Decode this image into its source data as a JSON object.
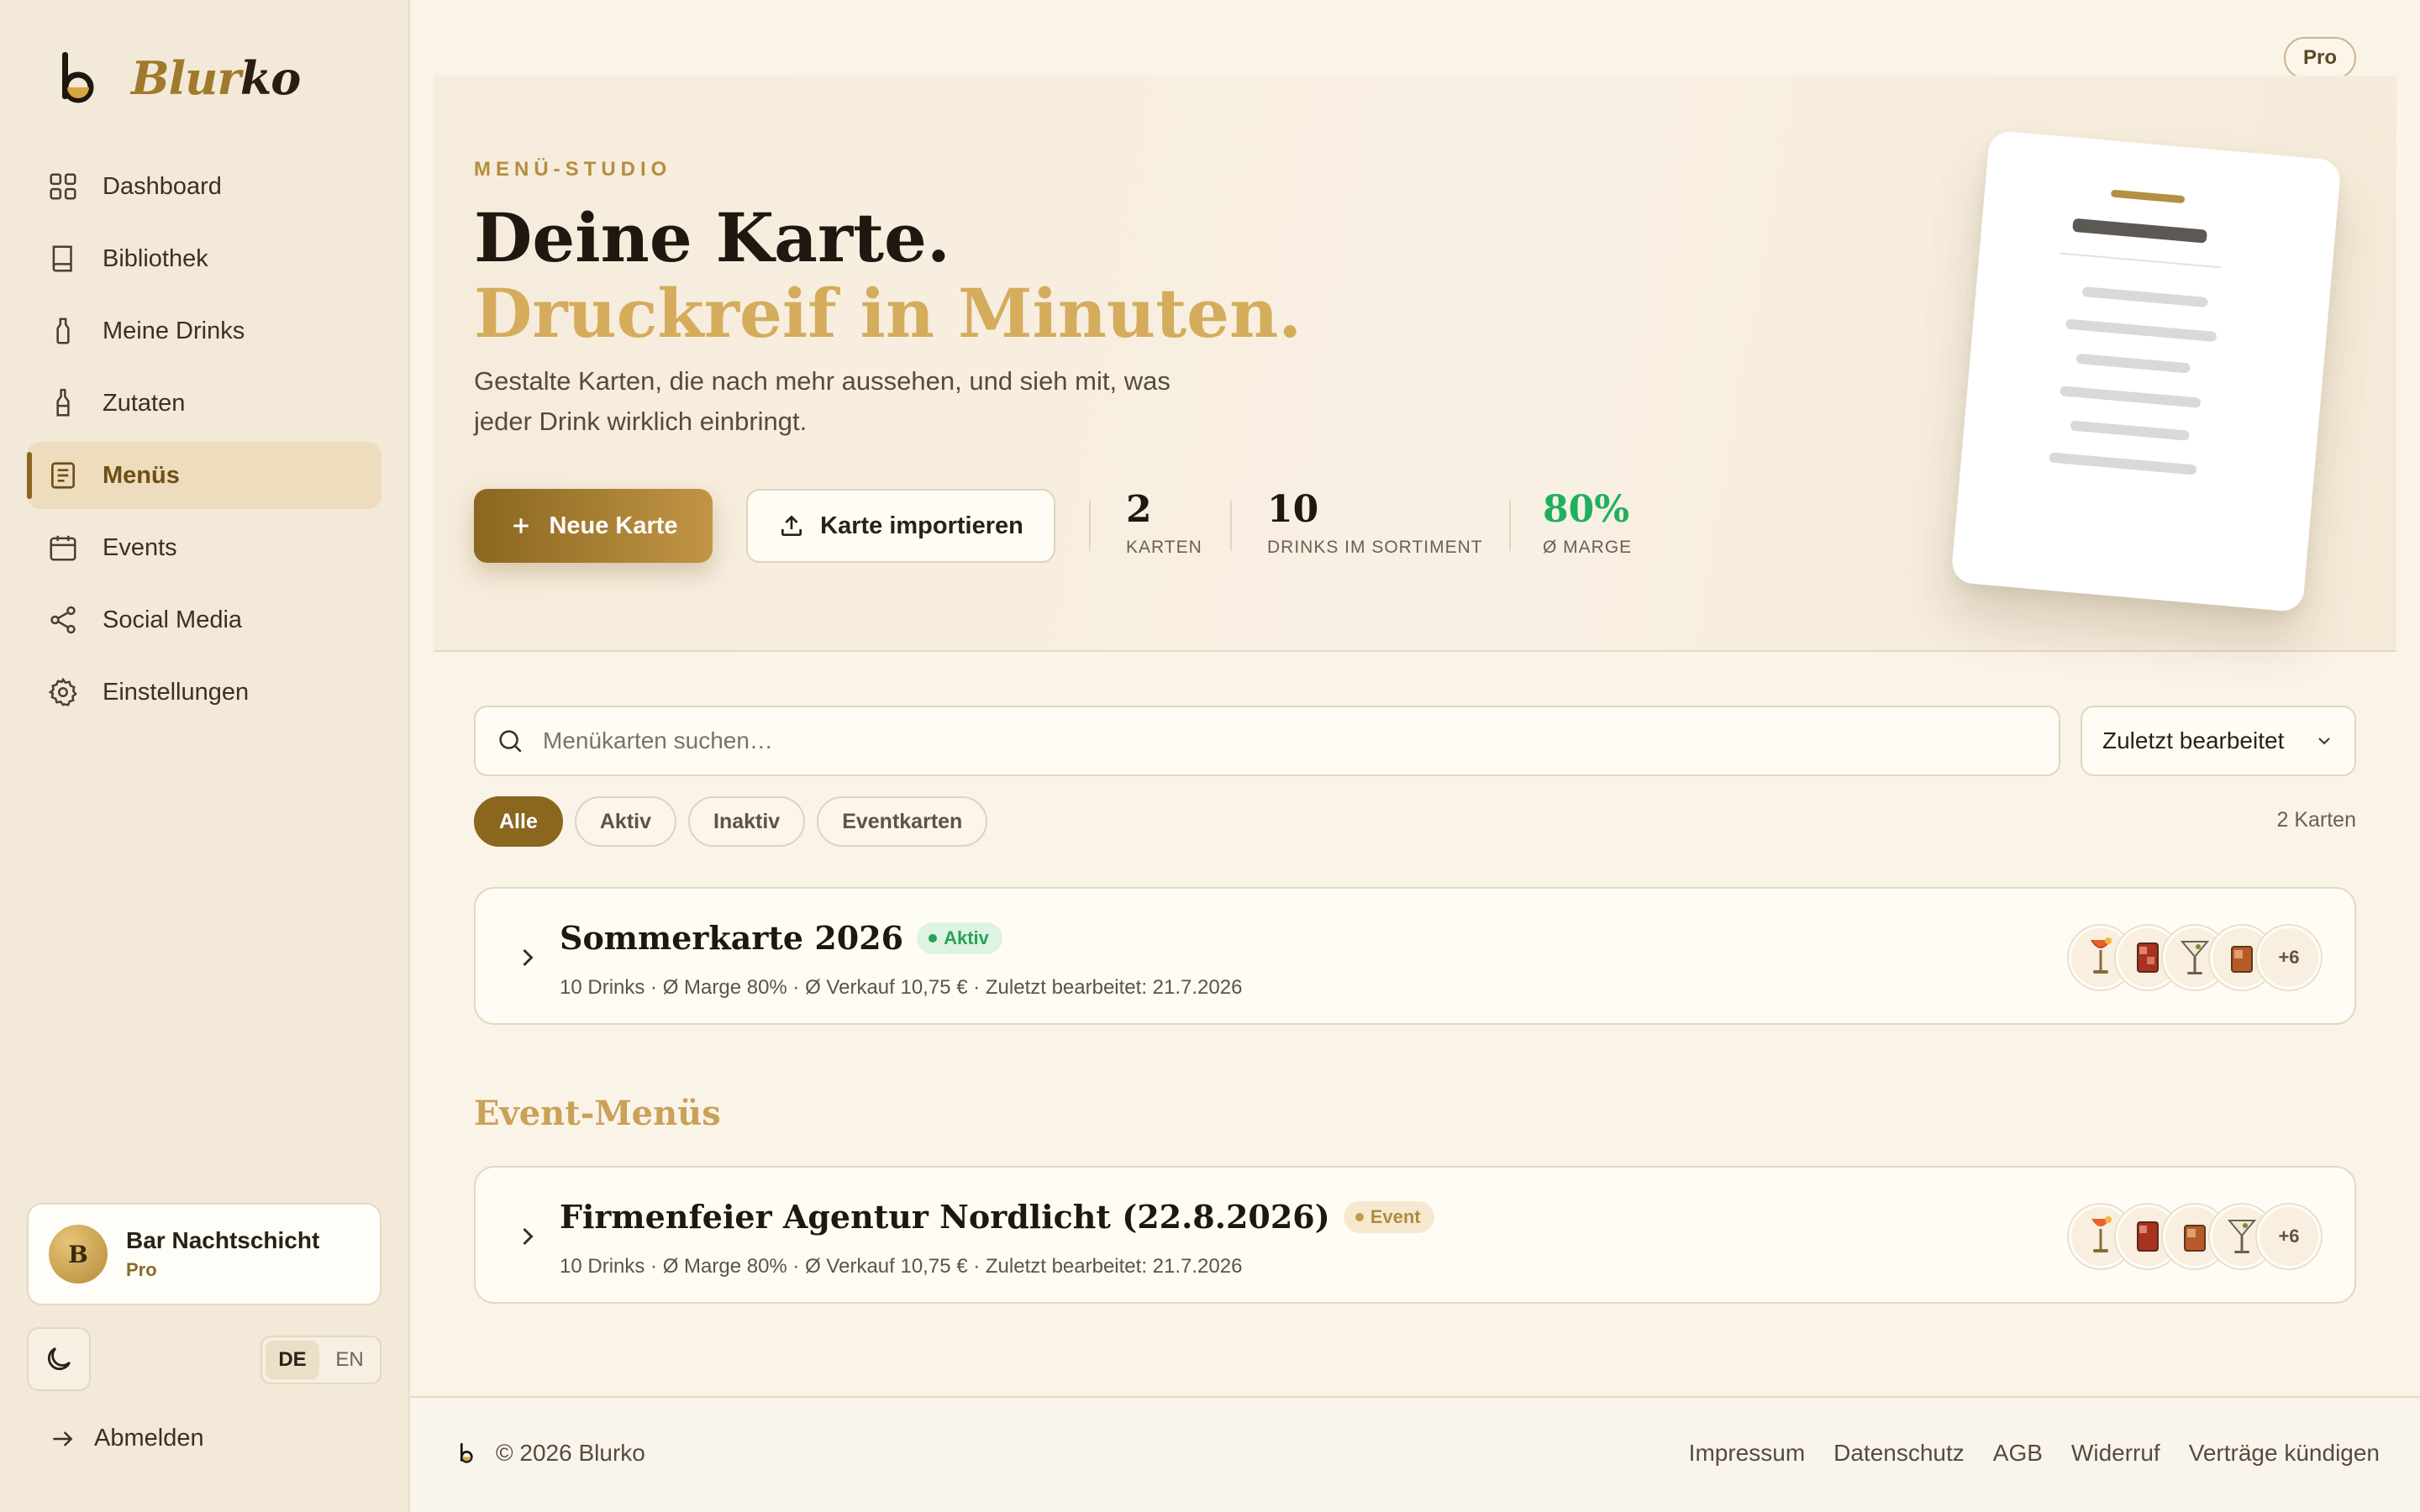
{
  "brand": {
    "name_part1": "Blur",
    "name_part2": "ko",
    "accent": "#8a661f",
    "gold_light": "#d4ac5c"
  },
  "sidebar": {
    "items": [
      {
        "label": "Dashboard",
        "icon": "grid-icon"
      },
      {
        "label": "Bibliothek",
        "icon": "book-icon"
      },
      {
        "label": "Meine Drinks",
        "icon": "bottle-icon"
      },
      {
        "label": "Zutaten",
        "icon": "flask-icon"
      },
      {
        "label": "Menüs",
        "icon": "menu-icon",
        "active": true
      },
      {
        "label": "Events",
        "icon": "calendar-icon"
      },
      {
        "label": "Social Media",
        "icon": "share-icon"
      },
      {
        "label": "Einstellungen",
        "icon": "gear-icon"
      }
    ],
    "profile": {
      "initial": "B",
      "name": "Bar Nachtschicht",
      "plan": "Pro"
    },
    "lang": {
      "de": "DE",
      "en": "EN",
      "selected": "DE"
    },
    "logout": "Abmelden"
  },
  "header": {
    "plan_badge": "Pro"
  },
  "hero": {
    "eyebrow": "MENÜ-STUDIO",
    "title_line1": "Deine Karte.",
    "title_line2": "Druckreif in Minuten.",
    "lead": "Gestalte Karten, die nach mehr aussehen, und sieh mit, was jeder Drink wirklich einbringt.",
    "primary_button": "Neue Karte",
    "secondary_button": "Karte importieren",
    "stats": [
      {
        "value": "2",
        "label": "KARTEN"
      },
      {
        "value": "10",
        "label": "DRINKS IM SORTIMENT"
      },
      {
        "value": "80%",
        "label": "Ø MARGE",
        "color": "#1fb05f"
      }
    ]
  },
  "search": {
    "placeholder": "Menükarten suchen…",
    "value": ""
  },
  "sort": {
    "selected": "Zuletzt bearbeitet"
  },
  "filters": [
    "Alle",
    "Aktiv",
    "Inaktiv",
    "Eventkarten"
  ],
  "filter_selected": "Alle",
  "count_label": "2 Karten",
  "cards": [
    {
      "title": "Sommerkarte 2026",
      "badge": "Aktiv",
      "meta": "10 Drinks · Ø Marge 80% · Ø Verkauf 10,75 € · Zuletzt bearbeitet: 21.7.2026",
      "thumbs": [
        "spritz-icon",
        "negroni-icon",
        "martini-icon",
        "oldfashioned-icon"
      ],
      "more": "+6"
    }
  ],
  "event_section": {
    "title": "Event-Menüs",
    "cards": [
      {
        "title": "Firmenfeier Agentur Nordlicht (22.8.2026)",
        "badge": "Event",
        "meta": "10 Drinks · Ø Marge 80% · Ø Verkauf 10,75 € · Zuletzt bearbeitet: 21.7.2026",
        "thumbs": [
          "spritz-icon",
          "negroni-icon",
          "oldfashioned-icon",
          "martini-icon"
        ],
        "more": "+6"
      }
    ]
  },
  "footer": {
    "copyright": "© 2026 Blurko",
    "links": [
      "Impressum",
      "Datenschutz",
      "AGB",
      "Widerruf",
      "Verträge kündigen"
    ]
  }
}
